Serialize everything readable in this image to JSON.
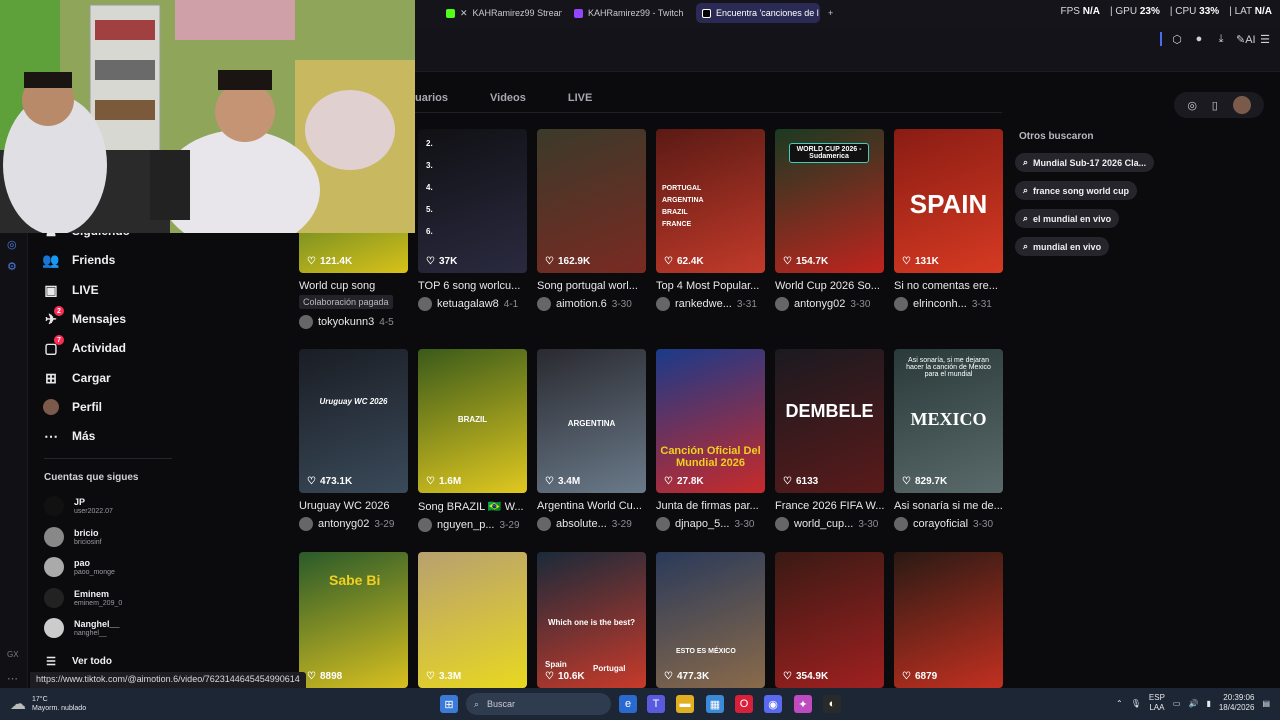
{
  "browser": {
    "tabs": [
      {
        "label": "KAHRamirez99 Stream",
        "color": "#53fc18",
        "active": false
      },
      {
        "label": "KAHRamirez99 - Twitch",
        "color": "#9146ff",
        "active": false
      },
      {
        "label": "Encuentra 'canciones de l",
        "color": "#111111",
        "active": true
      }
    ],
    "new_tab": "+",
    "perf": {
      "fps_label": "FPS",
      "fps": "N/A",
      "gpu_label": "GPU",
      "gpu": "23%",
      "cpu_label": "CPU",
      "cpu": "33%",
      "lat_label": "LAT",
      "lat": "N/A"
    },
    "ai_label": "AI"
  },
  "search_tabs": [
    "uarios",
    "Videos",
    "LIVE"
  ],
  "sidebar": {
    "items": [
      {
        "label": "Siguiendo",
        "icon": "following-icon"
      },
      {
        "label": "Friends",
        "icon": "friends-icon"
      },
      {
        "label": "LIVE",
        "icon": "live-icon"
      },
      {
        "label": "Mensajes",
        "icon": "messages-icon",
        "badge": "2"
      },
      {
        "label": "Actividad",
        "icon": "activity-icon",
        "badge": "7"
      },
      {
        "label": "Cargar",
        "icon": "upload-icon"
      },
      {
        "label": "Perfil",
        "icon": "profile-icon"
      },
      {
        "label": "Más",
        "icon": "more-icon"
      }
    ],
    "following_title": "Cuentas que sigues",
    "following": [
      {
        "name": "JP",
        "user": "user2022.07"
      },
      {
        "name": "bricio",
        "user": "briciosinf"
      },
      {
        "name": "pao",
        "user": "paoo_monge"
      },
      {
        "name": "Eminem",
        "user": "eminem_209_0"
      },
      {
        "name": "Nanghel__",
        "user": "nanghel__"
      }
    ],
    "see_all": "Ver todo"
  },
  "grid": [
    {
      "likes": "121.4K",
      "title": "World cup song",
      "tag": "Colaboración pagada",
      "author": "tokyokunn3",
      "date": "4-5",
      "c1": "#0f5a2a",
      "c2": "#d8c11a"
    },
    {
      "likes": "37K",
      "title": "TOP 6 song worlcu...",
      "author": "ketuagalaw8",
      "date": "4-1",
      "c1": "#101014",
      "c2": "#2a2a40"
    },
    {
      "likes": "162.9K",
      "title": "Song portugal worl...",
      "author": "aimotion.6",
      "date": "3-30",
      "c1": "#3b3a2a",
      "c2": "#7a2a22"
    },
    {
      "likes": "62.4K",
      "title": "Top 4 Most Popular...",
      "author": "rankedwe...",
      "date": "3-31",
      "c1": "#5a1a14",
      "c2": "#c23a2a"
    },
    {
      "likes": "154.7K",
      "title": "World Cup 2026 So...",
      "author": "antonyg02",
      "date": "3-30",
      "c1": "#1a3a22",
      "c2": "#c0241e"
    },
    {
      "likes": "131K",
      "title": "Si no comentas ere...",
      "author": "elrinconh...",
      "date": "3-31",
      "c1": "#8a1c14",
      "c2": "#d63a22"
    },
    {
      "likes": "473.1K",
      "title": "Uruguay WC 2026",
      "author": "antonyg02",
      "date": "3-29",
      "c1": "#1a1d24",
      "c2": "#3a4a5a"
    },
    {
      "likes": "1.6M",
      "title": "Song BRAZIL 🇧🇷 W...",
      "author": "nguyen_p...",
      "date": "3-29",
      "c1": "#3a5a1a",
      "c2": "#e0c820"
    },
    {
      "likes": "3.4M",
      "title": "Argentina World Cu...",
      "author": "absolute...",
      "date": "3-29",
      "c1": "#2a2a30",
      "c2": "#6a7a8a"
    },
    {
      "likes": "27.8K",
      "title": "Junta de firmas par...",
      "author": "djnapo_5...",
      "date": "3-30",
      "c1": "#1a3a8a",
      "c2": "#c82a2a"
    },
    {
      "likes": "6133",
      "title": "France 2026 FIFA W...",
      "author": "world_cup...",
      "date": "3-30",
      "c1": "#1a1a20",
      "c2": "#5a1a1a"
    },
    {
      "likes": "829.7K",
      "title": "Asi sonaría si me de...",
      "author": "corayoficial",
      "date": "3-30",
      "c1": "#2a3a3a",
      "c2": "#5a6a6a"
    },
    {
      "likes": "8898",
      "c1": "#2a5a2a",
      "c2": "#d8c020"
    },
    {
      "likes": "3.3M",
      "c1": "#b8a070",
      "c2": "#e8d820"
    },
    {
      "likes": "10.6K",
      "c1": "#1a2a3a",
      "c2": "#c83a2a"
    },
    {
      "likes": "477.3K",
      "c1": "#2a3a5a",
      "c2": "#8a6a4a"
    },
    {
      "likes": "354.9K",
      "c1": "#3a1a14",
      "c2": "#a02020"
    },
    {
      "likes": "6879",
      "c1": "#2a1a14",
      "c2": "#c23020"
    }
  ],
  "overlay_texts": {
    "ranks": [
      "2.",
      "3.",
      "4.",
      "5.",
      "6."
    ],
    "wc_badge": "WORLD CUP 2026 - Sudamerica",
    "spain": "SPAIN",
    "uruguay": "Uruguay WC 2026",
    "mexico_caption": "Asi sonaría, si me dejaran hacer la canción de Mexico para el mundial",
    "mexico": "MEXICO",
    "cancion": "Canción Oficial Del Mundial 2026",
    "dembele": "DEMBELE",
    "which": "Which one is the best?",
    "spain2": "Spain",
    "portugal2": "Portugal",
    "esto": "ESTO ES MÉXICO",
    "sabe": "Sabe Bi",
    "portugal_list": [
      "PORTUGAL",
      "ARGENTINA",
      "BRAZIL",
      "FRANCE"
    ],
    "brazil": "BRAZIL",
    "argentina": "ARGENTINA"
  },
  "others_title": "Otros buscaron",
  "others": [
    "Mundial Sub-17 2026 Cla...",
    "france song world cup",
    "el mundial en vivo",
    "mundial en vivo"
  ],
  "status_url": "https://www.tiktok.com/@aimotion.6/video/7623144645454990614",
  "taskbar": {
    "temp": "17°C",
    "weather": "Mayorm. nublado",
    "search": "Buscar",
    "lang1": "ESP",
    "lang2": "LAA",
    "time": "20:39:06",
    "date": "18/4/2026"
  }
}
